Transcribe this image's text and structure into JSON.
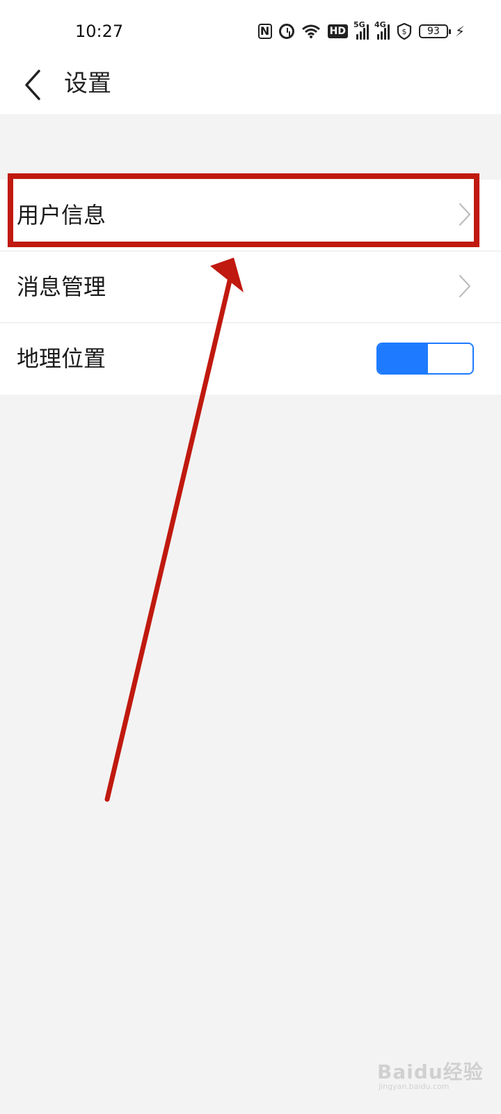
{
  "status_bar": {
    "time": "10:27",
    "battery_level": "93",
    "signal_labels": [
      "5G",
      "4G"
    ],
    "hd_label": "HD",
    "icons": [
      "nfc-icon",
      "alarm-icon",
      "wifi-icon",
      "hd-icon",
      "signal-5g-icon",
      "signal-4g-icon",
      "shield-icon",
      "battery-icon",
      "charging-icon"
    ]
  },
  "nav": {
    "title": "设置",
    "back_icon": "chevron-left-icon"
  },
  "settings": {
    "items": [
      {
        "label": "用户信息",
        "control": "chevron-right-icon"
      },
      {
        "label": "消息管理",
        "control": "chevron-right-icon"
      },
      {
        "label": "地理位置",
        "control": "toggle",
        "toggle_on": true
      }
    ]
  },
  "colors": {
    "accent": "#1e7bff",
    "annotation": "#c0190f",
    "background": "#f3f3f3"
  },
  "watermark": {
    "brand": "Baidu经验",
    "url": "jingyan.baidu.com"
  }
}
